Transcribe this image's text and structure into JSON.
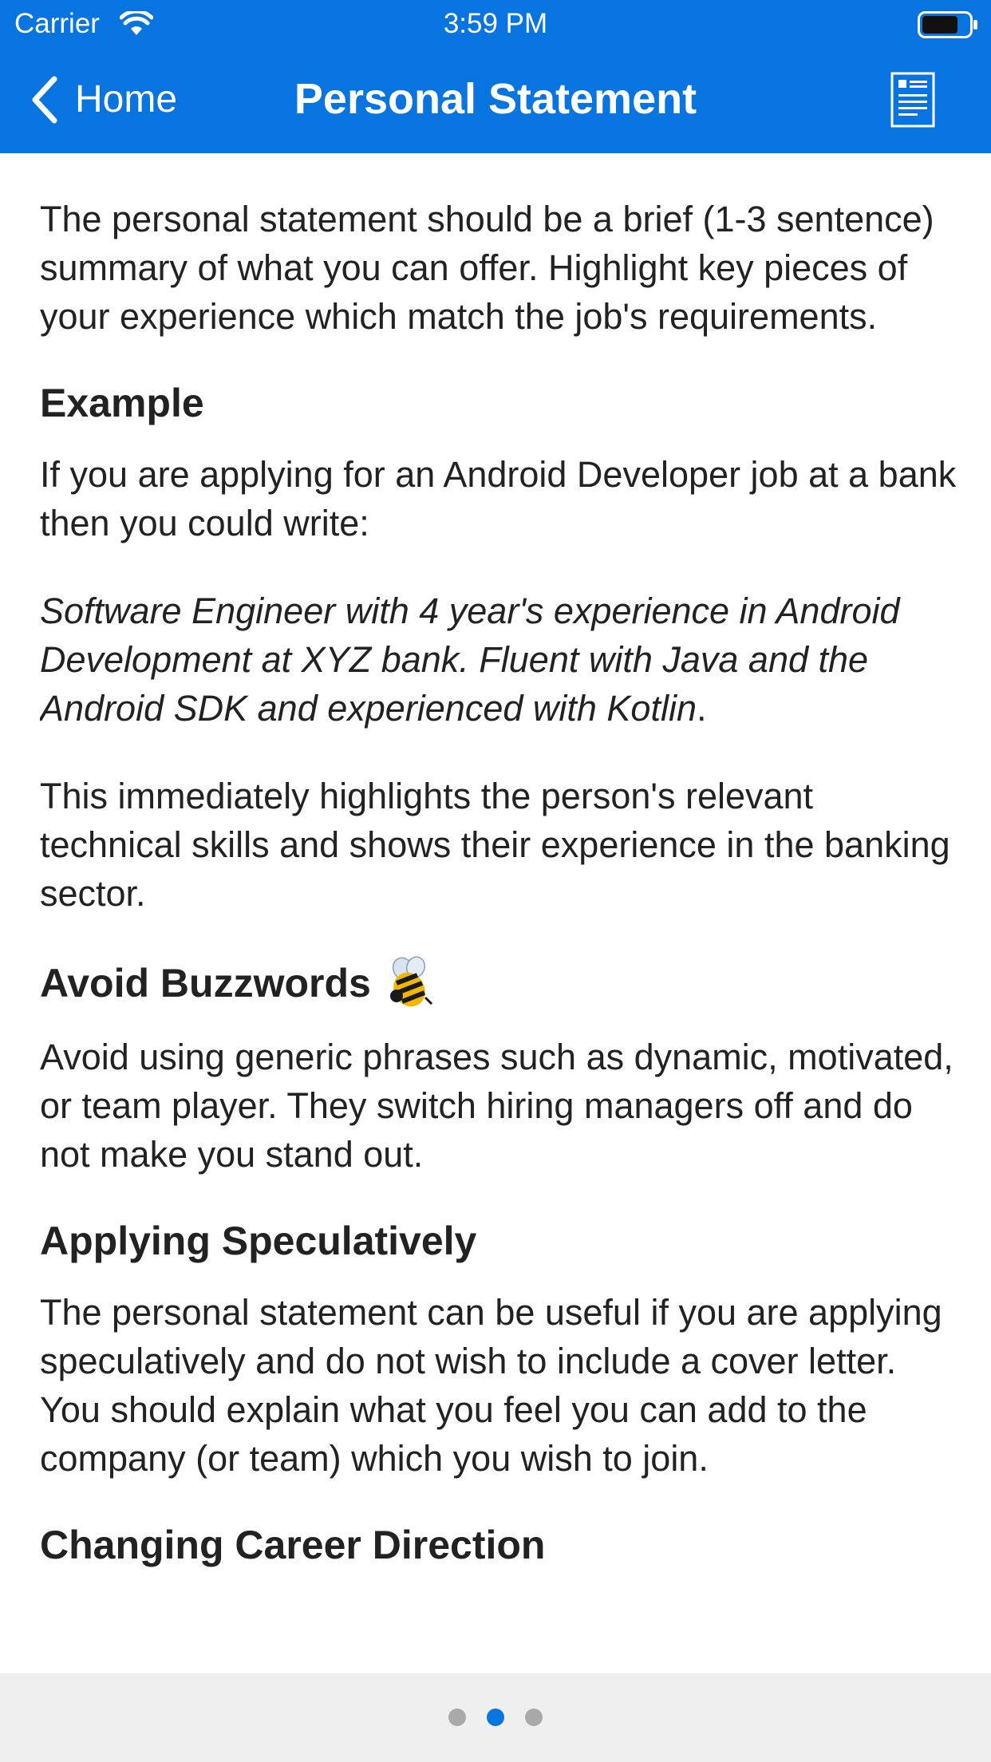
{
  "status_bar": {
    "carrier": "Carrier",
    "time": "3:59 PM",
    "wifi_icon": "wifi-icon",
    "battery_icon": "battery-icon"
  },
  "nav": {
    "back_label": "Home",
    "back_icon": "chevron-left-icon",
    "title": "Personal Statement",
    "right_icon": "document-icon"
  },
  "content": {
    "intro": "The personal statement should be a brief (1-3 sentence) summary of what you can offer. Highlight key pieces of your experience which match the job's requirements.",
    "example_heading": "Example",
    "example_text": "If you are applying for an Android Developer job at a bank then you could write:",
    "example_quote": "Software Engineer with 4 year's experience in Android Development at XYZ bank. Fluent with Java and the Android SDK and experienced with Kotlin",
    "example_quote_end": ".",
    "example_followup": "This immediately highlights the person's relevant technical skills and shows their experience in the banking sector.",
    "buzzwords_heading": "Avoid Buzzwords",
    "buzzwords_icon": "bee-icon",
    "buzzwords_text": "Avoid using generic phrases such as dynamic, motivated, or team player. They switch hiring managers off and do not make you stand out.",
    "speculative_heading": "Applying Speculatively",
    "speculative_text": "The personal statement can be useful if you are applying speculatively and do not wish to include a cover letter. You should explain what you feel you can add to the company (or team) which you wish to join.",
    "next_heading_partial": "Changing Career Direction"
  },
  "page_control": {
    "total_pages": 3,
    "current_page": 2,
    "active_color": "#0874e0",
    "inactive_color": "#a9a9ab"
  },
  "colors": {
    "header_background": "#0874e0",
    "header_text": "#ffffff",
    "body_text": "#222222",
    "footer_background": "#efeff0"
  }
}
